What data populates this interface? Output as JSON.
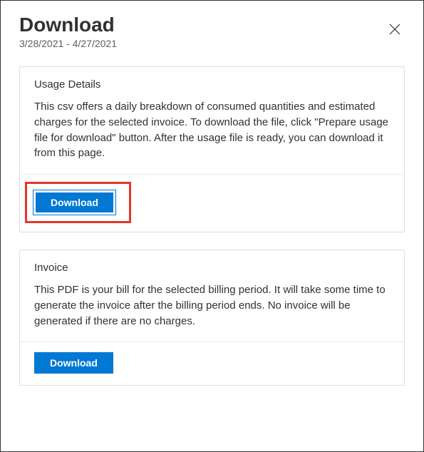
{
  "header": {
    "title": "Download",
    "date_range": "3/28/2021 - 4/27/2021"
  },
  "cards": {
    "usage": {
      "title": "Usage Details",
      "description": "This csv offers a daily breakdown of consumed quantities and estimated charges for the selected invoice. To download the file, click \"Prepare usage file for download\" button. After the usage file is ready, you can download it from this page.",
      "button_label": "Download"
    },
    "invoice": {
      "title": "Invoice",
      "description": "This PDF is your bill for the selected billing period. It will take some time to generate the invoice after the billing period ends. No invoice will be generated if there are no charges.",
      "button_label": "Download"
    }
  }
}
